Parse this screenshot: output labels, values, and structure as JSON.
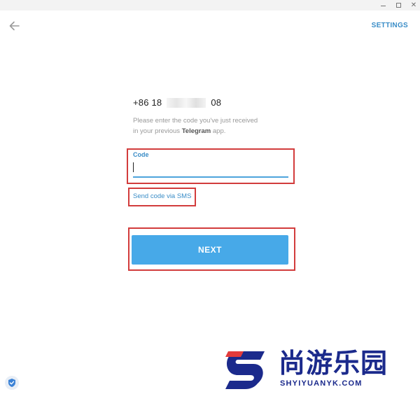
{
  "window": {
    "controls": {
      "minimize": "—",
      "maximize": "□",
      "close": "✕"
    }
  },
  "header": {
    "back_icon": "arrow-left-icon",
    "settings_label": "SETTINGS"
  },
  "login": {
    "phone_prefix": "+86 18",
    "phone_suffix": "08",
    "hint_line1": "Please enter the code you've just received",
    "hint_line2_pre": "in your previous ",
    "hint_app": "Telegram",
    "hint_line2_post": " app.",
    "code_label": "Code",
    "code_value": "",
    "sms_link": "Send code via SMS",
    "next_label": "NEXT"
  },
  "badge": {
    "icon": "shield-check-icon"
  },
  "watermark": {
    "text": "尚游乐园",
    "url": "SHYIYUANYK.COM"
  },
  "colors": {
    "accent": "#3a8dc7",
    "button": "#47a9e8",
    "highlight": "#d23c3c",
    "watermark": "#1b2a8c"
  }
}
